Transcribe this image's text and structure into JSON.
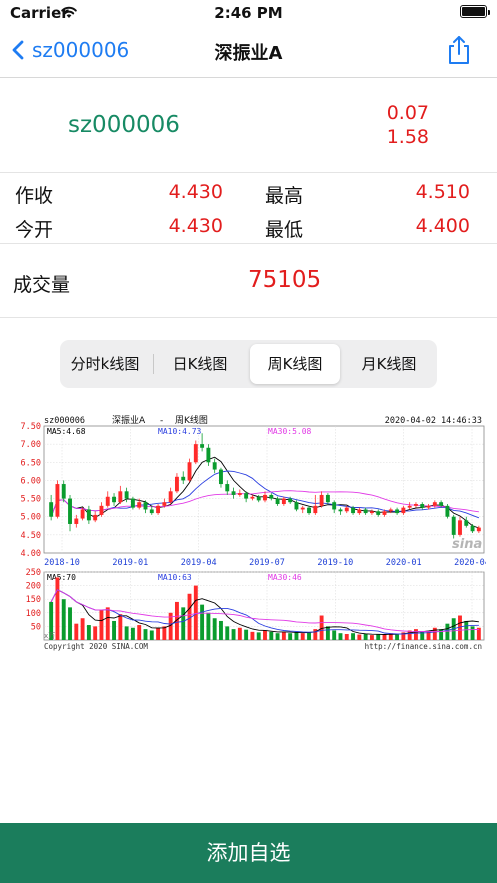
{
  "status_bar": {
    "carrier": "Carrier",
    "time": "2:46 PM"
  },
  "nav": {
    "back_label": "sz000006",
    "title": "深振业A"
  },
  "quote": {
    "code": "sz000006",
    "change": "0.07",
    "change_pct": "1.58"
  },
  "stats": [
    {
      "label": "作收",
      "value": "4.430"
    },
    {
      "label": "最高",
      "value": "4.510"
    },
    {
      "label": "今开",
      "value": "4.430"
    },
    {
      "label": "最低",
      "value": "4.400"
    }
  ],
  "volume": {
    "label": "成交量",
    "value": "75105"
  },
  "tabs": [
    {
      "label": "分时k线图",
      "active": false
    },
    {
      "label": "日K线图",
      "active": false
    },
    {
      "label": "周K线图",
      "active": true
    },
    {
      "label": "月K线图",
      "active": false
    }
  ],
  "chart": {
    "code": "sz000006",
    "name": "深振业A",
    "type_label": "周K线图",
    "timestamp": "2020-04-02  14:46:33",
    "ma_price": {
      "ma5": "MA5:4.68",
      "ma10": "MA10:4.73",
      "ma30": "MA30:5.08"
    },
    "ma_volume": {
      "ma5": "MA5:70",
      "ma10": "MA10:63",
      "ma30": "MA30:46"
    },
    "price_ticks": [
      "7.50",
      "7.00",
      "6.50",
      "6.00",
      "5.50",
      "5.00",
      "4.50",
      "4.00"
    ],
    "volume_ticks": [
      "250",
      "200",
      "150",
      "100",
      "50"
    ],
    "volume_unit": "x万",
    "date_ticks": [
      "2018-10",
      "2019-01",
      "2019-04",
      "2019-07",
      "2019-10",
      "2020-01",
      "2020-04"
    ],
    "watermark": "sina",
    "copyright": "Copyright 2020 SINA.COM",
    "source_url": "http://finance.sina.com.cn",
    "colors": {
      "up": "#ff2a2a",
      "down": "#0a9c2e",
      "ma5": "#000000",
      "ma10": "#2b3fe0",
      "ma30": "#e13ae6"
    }
  },
  "action": {
    "add_label": "添加自选"
  },
  "chart_data": {
    "type": "candlestick",
    "title": "深振业A  -  周K线图",
    "x_ticks": [
      "2018-10",
      "2019-01",
      "2019-04",
      "2019-07",
      "2019-10",
      "2020-01",
      "2020-04"
    ],
    "price_ylim": [
      4.0,
      7.5
    ],
    "volume_ylim": [
      0,
      250
    ],
    "candles": [
      [
        5.4,
        5.0,
        5.6,
        4.9,
        140
      ],
      [
        5.0,
        5.9,
        6.0,
        4.95,
        230
      ],
      [
        5.9,
        5.5,
        6.0,
        5.4,
        150
      ],
      [
        5.5,
        4.8,
        5.6,
        4.6,
        120
      ],
      [
        4.8,
        4.95,
        5.05,
        4.7,
        60
      ],
      [
        4.95,
        5.2,
        5.25,
        4.9,
        80
      ],
      [
        5.2,
        4.9,
        5.3,
        4.8,
        55
      ],
      [
        4.9,
        5.05,
        5.15,
        4.85,
        50
      ],
      [
        5.05,
        5.3,
        5.4,
        5.0,
        110
      ],
      [
        5.3,
        5.55,
        5.7,
        5.25,
        120
      ],
      [
        5.55,
        5.4,
        5.65,
        5.3,
        70
      ],
      [
        5.4,
        5.7,
        5.85,
        5.35,
        95
      ],
      [
        5.7,
        5.5,
        5.8,
        5.4,
        50
      ],
      [
        5.5,
        5.25,
        5.55,
        5.2,
        45
      ],
      [
        5.25,
        5.4,
        5.5,
        5.2,
        55
      ],
      [
        5.4,
        5.2,
        5.45,
        5.1,
        40
      ],
      [
        5.2,
        5.1,
        5.3,
        5.05,
        35
      ],
      [
        5.1,
        5.3,
        5.35,
        5.05,
        45
      ],
      [
        5.3,
        5.4,
        5.5,
        5.25,
        50
      ],
      [
        5.4,
        5.7,
        5.8,
        5.35,
        100
      ],
      [
        5.7,
        6.1,
        6.2,
        5.65,
        140
      ],
      [
        6.1,
        6.0,
        6.25,
        5.9,
        120
      ],
      [
        6.0,
        6.5,
        6.6,
        5.95,
        170
      ],
      [
        6.5,
        7.0,
        7.1,
        6.45,
        200
      ],
      [
        7.0,
        6.9,
        7.3,
        6.8,
        130
      ],
      [
        6.9,
        6.5,
        7.0,
        6.4,
        100
      ],
      [
        6.5,
        6.3,
        6.6,
        6.2,
        80
      ],
      [
        6.3,
        5.9,
        6.35,
        5.8,
        70
      ],
      [
        5.9,
        5.7,
        6.0,
        5.6,
        50
      ],
      [
        5.7,
        5.6,
        5.8,
        5.5,
        40
      ],
      [
        5.6,
        5.65,
        5.75,
        5.55,
        45
      ],
      [
        5.65,
        5.5,
        5.7,
        5.4,
        38
      ],
      [
        5.5,
        5.55,
        5.6,
        5.45,
        30
      ],
      [
        5.55,
        5.45,
        5.6,
        5.4,
        28
      ],
      [
        5.45,
        5.6,
        5.7,
        5.4,
        35
      ],
      [
        5.6,
        5.5,
        5.65,
        5.45,
        30
      ],
      [
        5.5,
        5.35,
        5.55,
        5.3,
        25
      ],
      [
        5.35,
        5.5,
        5.55,
        5.3,
        30
      ],
      [
        5.5,
        5.4,
        5.55,
        5.35,
        25
      ],
      [
        5.4,
        5.2,
        5.45,
        5.15,
        30
      ],
      [
        5.2,
        5.25,
        5.3,
        5.1,
        25
      ],
      [
        5.25,
        5.1,
        5.3,
        5.05,
        28
      ],
      [
        5.1,
        5.3,
        5.6,
        5.05,
        40
      ],
      [
        5.3,
        5.6,
        5.7,
        5.25,
        90
      ],
      [
        5.6,
        5.4,
        5.65,
        5.35,
        50
      ],
      [
        5.4,
        5.2,
        5.45,
        5.1,
        35
      ],
      [
        5.2,
        5.15,
        5.25,
        5.05,
        25
      ],
      [
        5.15,
        5.25,
        5.3,
        5.1,
        22
      ],
      [
        5.25,
        5.1,
        5.3,
        5.05,
        25
      ],
      [
        5.1,
        5.2,
        5.25,
        5.05,
        20
      ],
      [
        5.2,
        5.1,
        5.25,
        5.05,
        22
      ],
      [
        5.1,
        5.15,
        5.2,
        5.05,
        18
      ],
      [
        5.15,
        5.05,
        5.2,
        5.0,
        20
      ],
      [
        5.05,
        5.15,
        5.2,
        5.0,
        22
      ],
      [
        5.15,
        5.2,
        5.25,
        5.1,
        25
      ],
      [
        5.2,
        5.1,
        5.25,
        5.05,
        20
      ],
      [
        5.1,
        5.25,
        5.3,
        5.05,
        28
      ],
      [
        5.25,
        5.3,
        5.4,
        5.2,
        35
      ],
      [
        5.3,
        5.35,
        5.4,
        5.25,
        40
      ],
      [
        5.35,
        5.25,
        5.4,
        5.2,
        30
      ],
      [
        5.25,
        5.3,
        5.35,
        5.2,
        32
      ],
      [
        5.3,
        5.4,
        5.45,
        5.25,
        45
      ],
      [
        5.4,
        5.3,
        5.45,
        5.25,
        40
      ],
      [
        5.3,
        5.0,
        5.35,
        4.95,
        60
      ],
      [
        5.0,
        4.5,
        5.05,
        4.4,
        80
      ],
      [
        4.5,
        4.9,
        5.0,
        4.45,
        90
      ],
      [
        4.9,
        4.75,
        5.0,
        4.7,
        70
      ],
      [
        4.75,
        4.6,
        4.8,
        4.55,
        50
      ],
      [
        4.6,
        4.7,
        4.75,
        4.55,
        45
      ]
    ]
  }
}
